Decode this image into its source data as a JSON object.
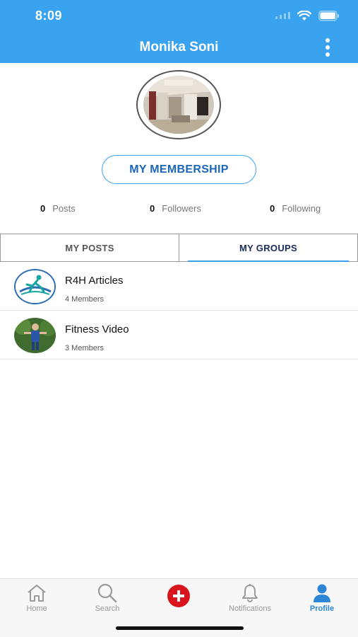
{
  "status_bar": {
    "time": "8:09"
  },
  "header": {
    "title": "Monika Soni"
  },
  "profile": {
    "membership_label": "MY MEMBERSHIP",
    "stats": [
      {
        "count": "0",
        "label": "Posts"
      },
      {
        "count": "0",
        "label": "Followers"
      },
      {
        "count": "0",
        "label": "Following"
      }
    ]
  },
  "tabs": [
    {
      "label": "MY POSTS",
      "active": false
    },
    {
      "label": "MY GROUPS",
      "active": true
    }
  ],
  "groups": [
    {
      "name": "R4H Articles",
      "members": "4 Members"
    },
    {
      "name": "Fitness Video",
      "members": "3 Members"
    }
  ],
  "bottom_nav": [
    {
      "label": "Home",
      "icon": "home-icon"
    },
    {
      "label": "Search",
      "icon": "search-icon"
    },
    {
      "label": "",
      "icon": "add-post-icon"
    },
    {
      "label": "Notifications",
      "icon": "bell-icon"
    },
    {
      "label": "Profile",
      "icon": "profile-icon",
      "active": true
    }
  ],
  "colors": {
    "header_bg": "#3aa3f0",
    "accent_blue": "#1a66b8",
    "active_tab_text": "#1b2a5c",
    "add_button_red": "#d9141c"
  }
}
